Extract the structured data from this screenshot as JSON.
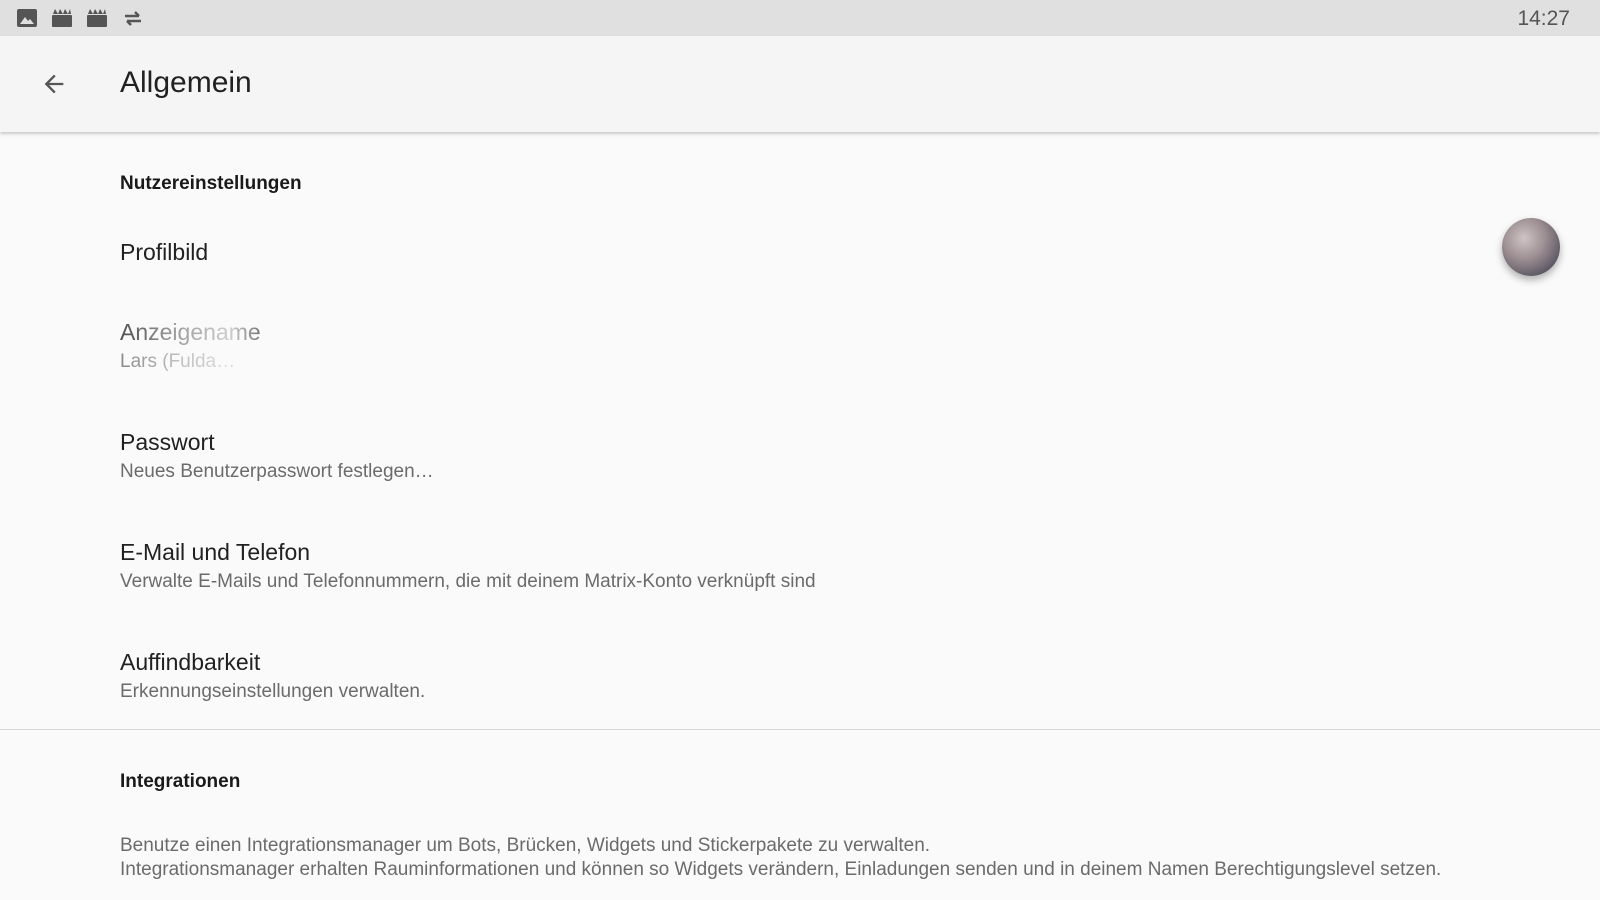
{
  "status_bar": {
    "icons": [
      "image-icon",
      "android-icon",
      "android-icon",
      "sync-arrows-icon"
    ],
    "time": "14:27"
  },
  "app_bar": {
    "back_icon": "arrow-back-icon",
    "title": "Allgemein"
  },
  "user_settings": {
    "header": "Nutzereinstellungen",
    "items": [
      {
        "title": "Profilbild",
        "summary": ""
      },
      {
        "title": "Anzeigename",
        "summary": "Lars (Fulda…"
      },
      {
        "title": "Passwort",
        "summary": "Neues Benutzerpasswort festlegen…"
      },
      {
        "title": "E-Mail und Telefon",
        "summary": "Verwalte E-Mails und Telefonnummern, die mit deinem Matrix-Konto verknüpft sind"
      },
      {
        "title": "Auffindbarkeit",
        "summary": "Erkennungseinstellungen verwalten."
      }
    ]
  },
  "integrations": {
    "header": "Integrationen",
    "line1": "Benutze einen Integrationsmanager um Bots, Brücken, Widgets und Stickerpakete zu verwalten.",
    "line2": "Integrationsmanager erhalten Rauminformationen und können so Widgets verändern, Einladungen senden und in deinem Namen Berechtigungslevel setzen."
  },
  "colors": {
    "status_bar_bg": "#e0e0e0",
    "app_bar_bg": "#f5f5f5",
    "page_bg": "#fafafa",
    "primary_text": "#212121",
    "secondary_text": "#6b6b6b"
  }
}
